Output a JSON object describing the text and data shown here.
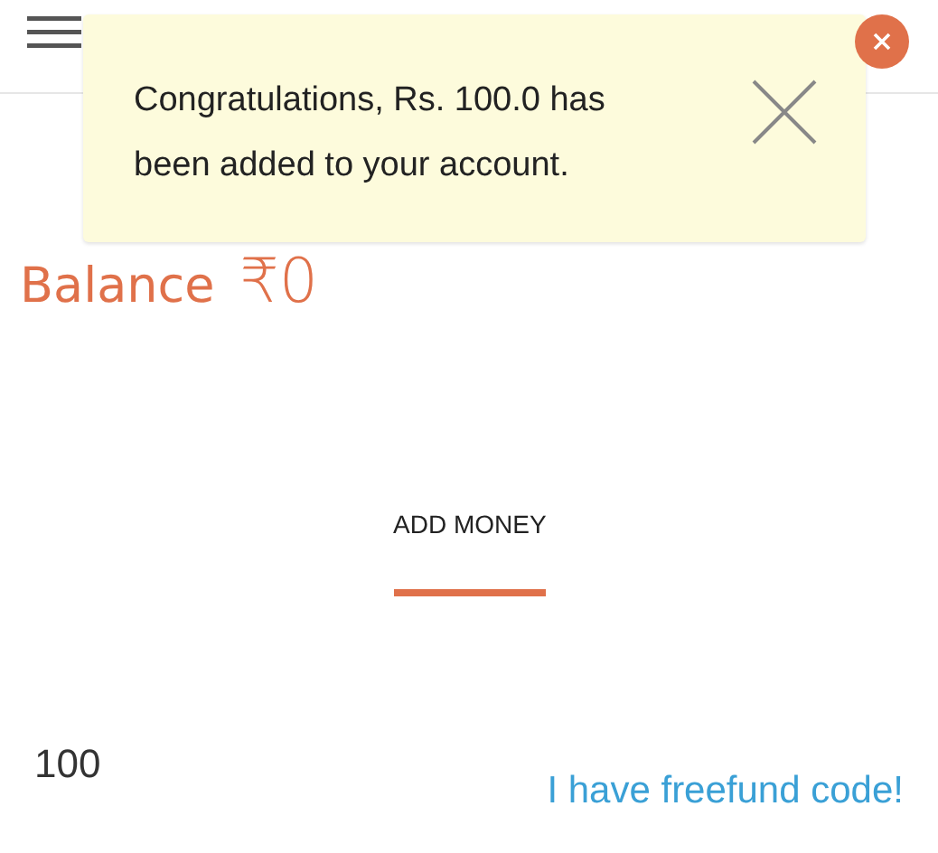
{
  "toast": {
    "message": "Congratulations, Rs. 100.0 has been added to your account."
  },
  "balance": {
    "label": "Balance",
    "amount": "₹0"
  },
  "tabs": [
    {
      "label": "ADD MONEY",
      "selected": true
    }
  ],
  "amount_field": {
    "value": "100"
  },
  "freefund_link": "I have freefund code!"
}
